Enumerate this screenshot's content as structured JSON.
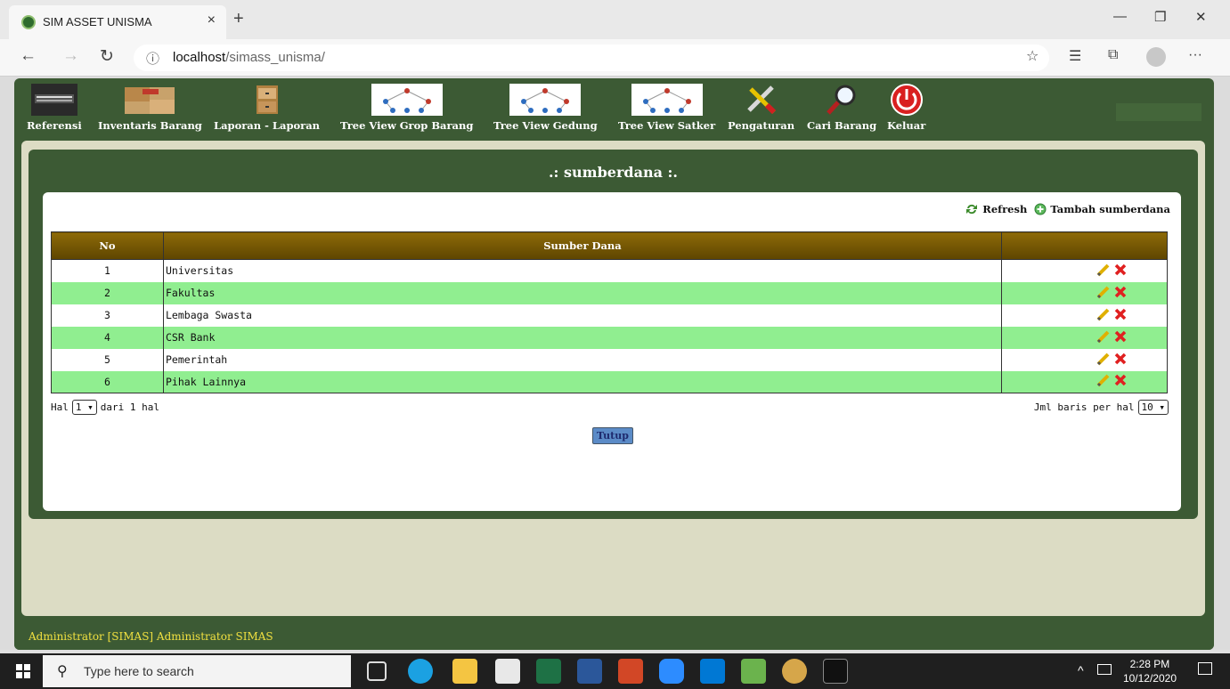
{
  "browser": {
    "tab_title": "SIM ASSET UNISMA",
    "close_tab": "×",
    "new_tab": "+",
    "url_host": "localhost",
    "url_path": "/simass_unisma/",
    "info_icon": "ⓘ",
    "back": "←",
    "forward": "→",
    "refresh": "↻",
    "favorite": "☆",
    "favorites": "☰",
    "collections": "⧉",
    "more": "···",
    "minimize": "—",
    "restore": "❐",
    "close": "✕"
  },
  "menu": [
    {
      "label": "Referensi",
      "icon": "inventory-management-icon"
    },
    {
      "label": "Inventaris Barang",
      "icon": "boxes-icon"
    },
    {
      "label": "Laporan - Laporan",
      "icon": "filing-cabinet-icon"
    },
    {
      "label": "Tree View Grop Barang",
      "icon": "tree-diagram-icon"
    },
    {
      "label": "Tree View Gedung",
      "icon": "tree-diagram-icon"
    },
    {
      "label": "Tree View Satker",
      "icon": "tree-diagram-icon"
    },
    {
      "label": "Pengaturan",
      "icon": "tools-icon"
    },
    {
      "label": "Cari Barang",
      "icon": "magnifier-icon"
    },
    {
      "label": "Keluar",
      "icon": "power-icon"
    }
  ],
  "panel": {
    "title": ".: sumberdana :.",
    "refresh_label": "Refresh",
    "add_label": "Tambah sumberdana"
  },
  "table": {
    "headers": [
      "No",
      "Sumber Dana",
      ""
    ],
    "rows": [
      {
        "no": "1",
        "name": "Universitas"
      },
      {
        "no": "2",
        "name": "Fakultas"
      },
      {
        "no": "3",
        "name": "Lembaga Swasta"
      },
      {
        "no": "4",
        "name": "CSR Bank"
      },
      {
        "no": "5",
        "name": "Pemerintah"
      },
      {
        "no": "6",
        "name": "Pihak Lainnya"
      }
    ]
  },
  "pager": {
    "hal_label": "Hal",
    "page": "1",
    "dari_label": "dari 1 hal",
    "per_page_label": "Jml baris per hal",
    "per_page": "10"
  },
  "close_button": "Tutup",
  "status": "Administrator [SIMAS] Administrator SIMAS",
  "taskbar": {
    "search_placeholder": "Type here to search",
    "time": "2:28 PM",
    "date": "10/12/2020"
  },
  "colors": {
    "app_green": "#3c5a34",
    "even_row": "#90ee90",
    "header_brown": "#7a5a05",
    "status_yellow": "#f0e040"
  }
}
